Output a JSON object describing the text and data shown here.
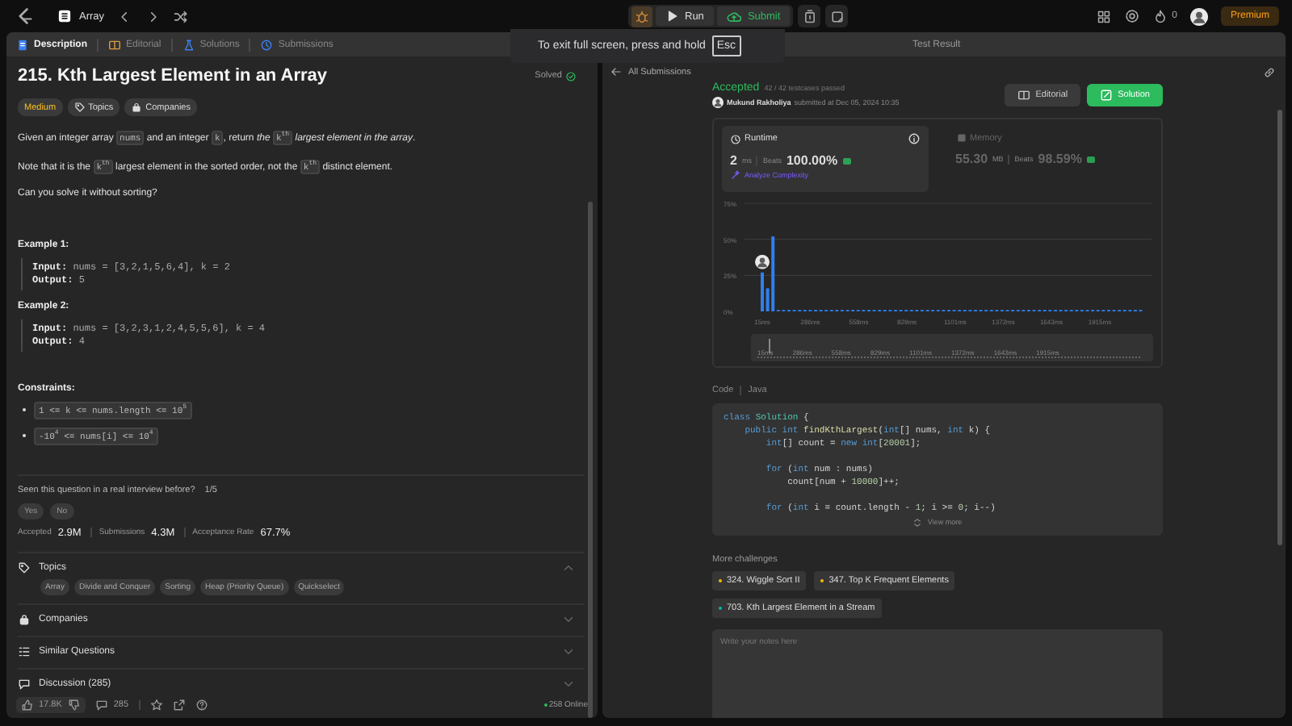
{
  "top_bar": {
    "problem_list": "Array",
    "run": "Run",
    "submit": "Submit",
    "streak": "0",
    "premium": "Premium"
  },
  "toast": {
    "text": "To exit full screen, press and hold",
    "key": "Esc"
  },
  "left_tabs": [
    {
      "label": "Description",
      "kind": "description",
      "selected": true
    },
    {
      "label": "Editorial",
      "kind": "editorial",
      "selected": false
    },
    {
      "label": "Solutions",
      "kind": "solutions",
      "selected": false
    },
    {
      "label": "Submissions",
      "kind": "submissions",
      "selected": false
    }
  ],
  "problem": {
    "title": "215. Kth Largest Element in an Array",
    "status": "Solved",
    "tags": [
      {
        "label": "Medium",
        "kind": "difficulty"
      },
      {
        "label": "Topics",
        "kind": "topics"
      },
      {
        "label": "Companies",
        "kind": "companies"
      }
    ],
    "paragraphs": [
      [
        {
          "kind": "text",
          "t": "Given an integer array "
        },
        {
          "kind": "code",
          "t": "nums"
        },
        {
          "kind": "text",
          "t": " and an integer "
        },
        {
          "kind": "code",
          "t": "k"
        },
        {
          "kind": "text",
          "t": ", return "
        },
        {
          "kind": "em",
          "t": "the "
        },
        {
          "kind": "code",
          "t": "k$^{th}$"
        },
        {
          "kind": "em",
          "t": " largest element in the array"
        },
        {
          "kind": "text",
          "t": "."
        }
      ],
      [
        {
          "kind": "text",
          "t": "Note that it is the "
        },
        {
          "kind": "code",
          "t": "k$^{th}$"
        },
        {
          "kind": "text",
          "t": " largest element in the sorted order, not the "
        },
        {
          "kind": "code",
          "t": "k$^{th}$"
        },
        {
          "kind": "text",
          "t": " distinct element."
        }
      ],
      [
        {
          "kind": "text",
          "t": "Can you solve it without sorting?"
        }
      ]
    ],
    "examples": [
      {
        "title": "Example 1:",
        "lines": [
          {
            "label": "Input:",
            "value": "nums = [3,2,1,5,6,4], k = 2"
          },
          {
            "label": "Output:",
            "value": "5"
          }
        ]
      },
      {
        "title": "Example 2:",
        "lines": [
          {
            "label": "Input:",
            "value": "nums = [3,2,3,1,2,4,5,5,6], k = 4"
          },
          {
            "label": "Output:",
            "value": "4"
          }
        ]
      }
    ],
    "constraints_title": "Constraints:",
    "constraints": [
      "1 <= k <= nums.length <= 10$^{5}$",
      "-10$^{4}$ <= nums[i] <= 10$^{4}$"
    ]
  },
  "interview": {
    "question": "Seen this question in a real interview before?",
    "count": "1/5",
    "answers": [
      "Yes",
      "No"
    ]
  },
  "stats": [
    {
      "label": "Accepted",
      "value": "2.9M"
    },
    {
      "label": "Submissions",
      "value": "4.3M"
    },
    {
      "label": "Acceptance Rate",
      "value": "67.7%"
    }
  ],
  "sections": [
    {
      "title": "Topics",
      "kind": "topics",
      "expanded": true,
      "chips": [
        "Array",
        "Divide and Conquer",
        "Sorting",
        "Heap (Priority Queue)",
        "Quickselect"
      ]
    },
    {
      "title": "Companies",
      "kind": "companies",
      "expanded": false
    },
    {
      "title": "Similar Questions",
      "kind": "similar",
      "expanded": false
    },
    {
      "title": "Discussion (285)",
      "kind": "discussion",
      "expanded": false
    }
  ],
  "bottom_bar": {
    "likes": "17.8K",
    "comments": "285",
    "online": "258 Online"
  },
  "right_tabs": [
    {
      "label": "Test Result"
    }
  ],
  "back_link": "All Submissions",
  "submission": {
    "status": "Accepted",
    "passed": "42 / 42 testcases passed",
    "user": "Mukund Rakholiya",
    "submitted": "submitted at Dec 05, 2024 10:35",
    "buttons": [
      {
        "label": "Editorial",
        "kind": "editorial"
      },
      {
        "label": "Solution",
        "kind": "solution"
      }
    ]
  },
  "metrics": [
    {
      "kind": "runtime",
      "label": "Runtime",
      "value": "2",
      "unit": "ms",
      "beats_label": "Beats",
      "beats": "100.00%",
      "link": "Analyze Complexity",
      "selected": true
    },
    {
      "kind": "memory",
      "label": "Memory",
      "value": "55.30",
      "unit": "MB",
      "beats_label": "Beats",
      "beats": "98.59%",
      "selected": false
    }
  ],
  "chart": {
    "chart_data": {
      "type": "bar",
      "x": [
        15,
        45,
        75,
        105,
        135,
        165,
        195,
        225,
        255,
        285,
        315,
        345,
        375,
        405,
        435,
        465,
        495,
        525,
        555,
        585,
        615,
        645,
        675,
        705,
        735,
        765,
        795,
        825,
        855,
        885,
        915,
        945,
        975,
        1005,
        1035,
        1065,
        1095,
        1125,
        1155,
        1185,
        1215,
        1245,
        1275,
        1305,
        1335,
        1365,
        1395,
        1425,
        1455,
        1485,
        1515,
        1545,
        1575,
        1605,
        1635,
        1665,
        1695,
        1725,
        1755,
        1785,
        1815,
        1845,
        1875,
        1905,
        1935,
        1965,
        1995,
        2025,
        2055,
        2085,
        2115,
        2145
      ],
      "series": [
        {
          "color": "#2f80ed",
          "values": [
            27,
            16,
            52,
            1,
            1,
            1,
            1,
            1,
            1,
            1,
            1,
            1,
            1,
            1,
            1,
            1,
            1,
            1,
            1,
            1,
            1,
            1,
            1,
            1,
            1,
            1,
            1,
            1,
            1,
            1,
            1,
            1,
            1,
            1,
            1,
            1,
            1,
            1,
            1,
            1,
            1,
            1,
            1,
            1,
            1,
            1,
            1,
            1,
            1,
            1,
            1,
            1,
            1,
            1,
            1,
            1,
            1,
            1,
            1,
            1,
            1,
            1,
            1,
            1,
            1,
            1,
            1,
            1,
            1,
            1,
            1,
            1
          ]
        }
      ],
      "xlim": [
        -85,
        2206
      ],
      "ylim": [
        0,
        75
      ],
      "yticks": [
        {
          "value": 0,
          "label": "0%"
        },
        {
          "value": 25,
          "label": "25%"
        },
        {
          "value": 50,
          "label": "50%"
        },
        {
          "value": 75,
          "label": "75%"
        }
      ],
      "xticks": [
        {
          "value": 15,
          "label": "15ms"
        },
        {
          "value": 286,
          "label": "286ms"
        },
        {
          "value": 558,
          "label": "558ms"
        },
        {
          "value": 829,
          "label": "829ms"
        },
        {
          "value": 1101,
          "label": "1101ms"
        },
        {
          "value": 1372,
          "label": "1372ms"
        },
        {
          "value": 1643,
          "label": "1643ms"
        },
        {
          "value": 1915,
          "label": "1915ms"
        }
      ]
    },
    "brush_labels": [
      "15ms",
      "286ms",
      "558ms",
      "829ms",
      "1101ms",
      "1372ms",
      "1643ms",
      "1915ms"
    ]
  },
  "code_header": {
    "label": "Code",
    "language": "Java"
  },
  "code": [
    {
      "segments": [
        {
          "kind": "kw",
          "t": "class "
        },
        {
          "kind": "type",
          "t": "Solution"
        },
        {
          "kind": "plain",
          "t": " {"
        }
      ]
    },
    {
      "segments": [
        {
          "kind": "kw",
          "t": "    public int "
        },
        {
          "kind": "fn",
          "t": "findKthLargest"
        },
        {
          "kind": "plain",
          "t": "("
        },
        {
          "kind": "kw",
          "t": "int"
        },
        {
          "kind": "plain",
          "t": "[] nums, "
        },
        {
          "kind": "kw",
          "t": "int"
        },
        {
          "kind": "plain",
          "t": " k) {"
        }
      ]
    },
    {
      "segments": [
        {
          "kind": "kw",
          "t": "        int"
        },
        {
          "kind": "plain",
          "t": "[] count = "
        },
        {
          "kind": "kw",
          "t": "new int"
        },
        {
          "kind": "plain",
          "t": "["
        },
        {
          "kind": "num",
          "t": "20001"
        },
        {
          "kind": "plain",
          "t": "];"
        }
      ]
    },
    {
      "kind": "blank"
    },
    {
      "segments": [
        {
          "kind": "kw",
          "t": "        for"
        },
        {
          "kind": "plain",
          "t": " ("
        },
        {
          "kind": "kw",
          "t": "int"
        },
        {
          "kind": "plain",
          "t": " num : nums)"
        }
      ]
    },
    {
      "segments": [
        {
          "kind": "plain",
          "t": "            count[num + "
        },
        {
          "kind": "num",
          "t": "10000"
        },
        {
          "kind": "plain",
          "t": "]++;"
        }
      ]
    },
    {
      "kind": "blank"
    },
    {
      "segments": [
        {
          "kind": "kw",
          "t": "        for"
        },
        {
          "kind": "plain",
          "t": " ("
        },
        {
          "kind": "kw",
          "t": "int"
        },
        {
          "kind": "plain",
          "t": " i = count.length - "
        },
        {
          "kind": "num",
          "t": "1"
        },
        {
          "kind": "plain",
          "t": "; i >= "
        },
        {
          "kind": "num",
          "t": "0"
        },
        {
          "kind": "plain",
          "t": "; i--)"
        }
      ]
    }
  ],
  "view_more": "View more",
  "challenges_title": "More challenges",
  "challenges": [
    {
      "label": "324. Wiggle Sort II",
      "color": "#ffb800"
    },
    {
      "label": "347. Top K Frequent Elements",
      "color": "#ffb800"
    },
    {
      "label": "703. Kth Largest Element in a Stream",
      "color": "#00b8a3"
    }
  ],
  "notes": {
    "placeholder": "Write your notes here"
  }
}
